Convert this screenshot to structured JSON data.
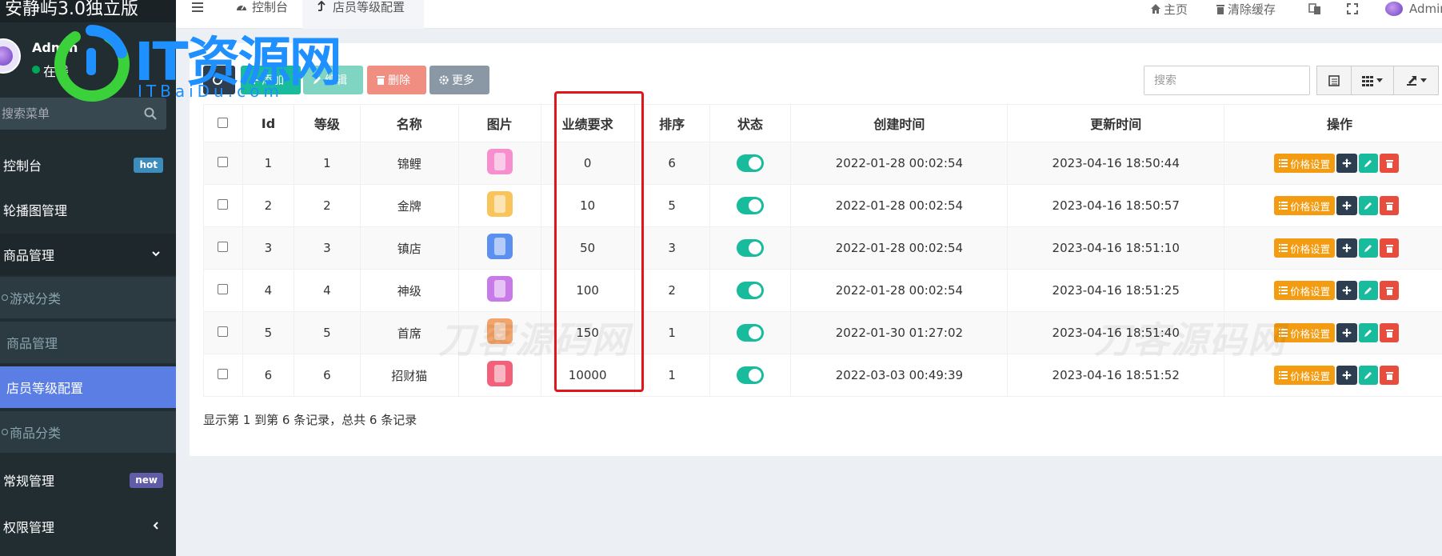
{
  "brand": {
    "title": "安静屿3.0独立版"
  },
  "user": {
    "name": "Admin",
    "status": "在线"
  },
  "sidebar": {
    "search_placeholder": "搜索菜单",
    "items": [
      {
        "label": "控制台",
        "badge": "hot",
        "badge_color": "#3c8dbc"
      },
      {
        "label": "轮播图管理"
      },
      {
        "label": "商品管理"
      },
      {
        "label": "游戏分类"
      },
      {
        "label": "商品管理"
      },
      {
        "label": "店员等级配置"
      },
      {
        "label": "商品分类"
      },
      {
        "label": "常规管理",
        "badge": "new",
        "badge_color": "#605ca8"
      },
      {
        "label": "权限管理"
      }
    ]
  },
  "header": {
    "tabs": [
      {
        "label": "控制台"
      },
      {
        "label": "店员等级配置"
      }
    ],
    "right": {
      "home": "主页",
      "clear_cache": "清除缓存",
      "user": "Admin"
    }
  },
  "toolbar": {
    "add_label": "添加",
    "edit_label": "编辑",
    "delete_label": "删除",
    "more_label": "更多",
    "search_placeholder": "搜索"
  },
  "table": {
    "columns": [
      "Id",
      "等级",
      "名称",
      "图片",
      "业绩要求",
      "排序",
      "状态",
      "创建时间",
      "更新时间",
      "操作"
    ],
    "rows": [
      {
        "id": "1",
        "level": "1",
        "name": "锦鲤",
        "requirement": "0",
        "sort": "6",
        "created": "2022-01-28 00:02:54",
        "updated": "2023-04-16 18:50:44",
        "image_color": "#f78fcf"
      },
      {
        "id": "2",
        "level": "2",
        "name": "金牌",
        "requirement": "10",
        "sort": "5",
        "created": "2022-01-28 00:02:54",
        "updated": "2023-04-16 18:50:57",
        "image_color": "#f9c45b"
      },
      {
        "id": "3",
        "level": "3",
        "name": "镇店",
        "requirement": "50",
        "sort": "3",
        "created": "2022-01-28 00:02:54",
        "updated": "2023-04-16 18:51:10",
        "image_color": "#5b8ff0"
      },
      {
        "id": "4",
        "level": "4",
        "name": "神级",
        "requirement": "100",
        "sort": "2",
        "created": "2022-01-28 00:02:54",
        "updated": "2023-04-16 18:51:25",
        "image_color": "#c77ae8"
      },
      {
        "id": "5",
        "level": "5",
        "name": "首席",
        "requirement": "150",
        "sort": "1",
        "created": "2022-01-30 01:27:02",
        "updated": "2023-04-16 18:51:40",
        "image_color": "#f2a46a"
      },
      {
        "id": "6",
        "level": "6",
        "name": "招财猫",
        "requirement": "10000",
        "sort": "1",
        "created": "2022-03-03 00:49:39",
        "updated": "2023-04-16 18:51:52",
        "image_color": "#f2607a"
      }
    ],
    "price_button_label": "价格设置",
    "footer": "显示第 1 到第 6 条记录，总共 6 条记录"
  },
  "watermarks": {
    "logo": "IT资源网",
    "logo_sub": "ITBaiDu.com",
    "mark": "刀客源码网"
  }
}
